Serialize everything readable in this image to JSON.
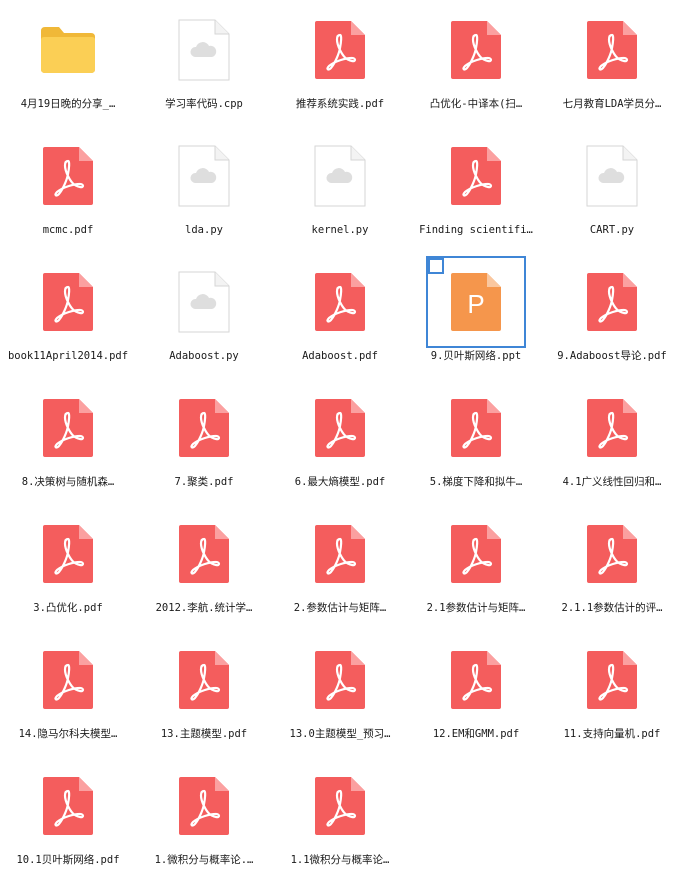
{
  "files": [
    {
      "name": "4月19日晚的分享_…",
      "type": "folder"
    },
    {
      "name": "学习率代码.cpp",
      "type": "code"
    },
    {
      "name": "推荐系统实践.pdf",
      "type": "pdf"
    },
    {
      "name": "凸优化-中译本(扫…",
      "type": "pdf"
    },
    {
      "name": "七月教育LDA学员分…",
      "type": "pdf"
    },
    {
      "name": "mcmc.pdf",
      "type": "pdf"
    },
    {
      "name": "lda.py",
      "type": "code"
    },
    {
      "name": "kernel.py",
      "type": "code"
    },
    {
      "name": "Finding scientifi…",
      "type": "pdf"
    },
    {
      "name": "CART.py",
      "type": "code"
    },
    {
      "name": "book11April2014.pdf",
      "type": "pdf"
    },
    {
      "name": "Adaboost.py",
      "type": "code"
    },
    {
      "name": "Adaboost.pdf",
      "type": "pdf"
    },
    {
      "name": "9.贝叶斯网络.ppt",
      "type": "ppt",
      "selected": true
    },
    {
      "name": "9.Adaboost导论.pdf",
      "type": "pdf"
    },
    {
      "name": "8.决策树与随机森…",
      "type": "pdf"
    },
    {
      "name": "7.聚类.pdf",
      "type": "pdf"
    },
    {
      "name": "6.最大熵模型.pdf",
      "type": "pdf"
    },
    {
      "name": "5.梯度下降和拟牛…",
      "type": "pdf"
    },
    {
      "name": "4.1广义线性回归和…",
      "type": "pdf"
    },
    {
      "name": "3.凸优化.pdf",
      "type": "pdf"
    },
    {
      "name": "2012.李航.统计学…",
      "type": "pdf"
    },
    {
      "name": "2.参数估计与矩阵…",
      "type": "pdf"
    },
    {
      "name": "2.1参数估计与矩阵…",
      "type": "pdf"
    },
    {
      "name": "2.1.1参数估计的评…",
      "type": "pdf"
    },
    {
      "name": "14.隐马尔科夫模型…",
      "type": "pdf"
    },
    {
      "name": "13.主题模型.pdf",
      "type": "pdf"
    },
    {
      "name": "13.0主题模型_预习…",
      "type": "pdf"
    },
    {
      "name": "12.EM和GMM.pdf",
      "type": "pdf"
    },
    {
      "name": "11.支持向量机.pdf",
      "type": "pdf"
    },
    {
      "name": "10.1贝叶斯网络.pdf",
      "type": "pdf"
    },
    {
      "name": "1.微积分与概率论.…",
      "type": "pdf"
    },
    {
      "name": "1.1微积分与概率论…",
      "type": "pdf"
    }
  ],
  "icons": {
    "folder": "folder-icon",
    "pdf": "pdf-file-icon",
    "code": "cloud-file-icon",
    "ppt": "ppt-file-icon"
  },
  "colors": {
    "pdf": "#f45d5d",
    "pdf_fold": "#fba0a0",
    "folder_back": "#f0b838",
    "folder_front": "#fbcf55",
    "ppt": "#f5964c",
    "ppt_fold": "#fac79f",
    "code_border": "#d6d6d6",
    "cloud": "#dedede",
    "selection": "#3f86d6"
  },
  "ppt_glyph": "P"
}
